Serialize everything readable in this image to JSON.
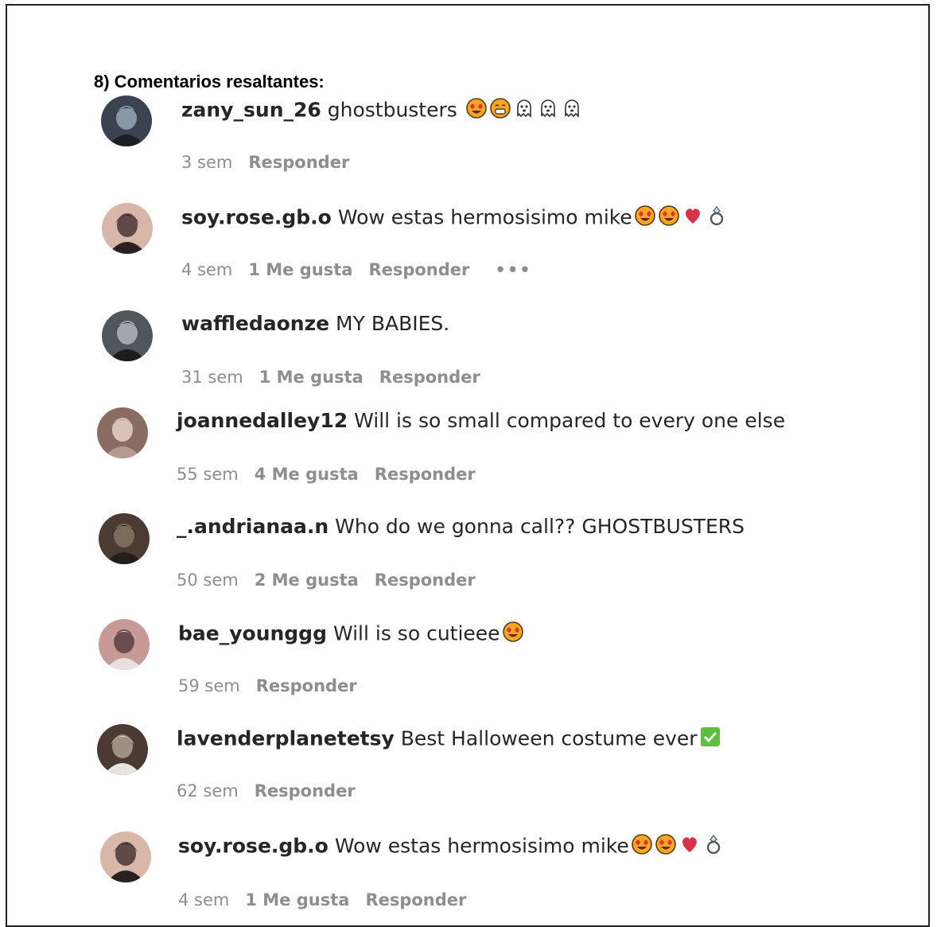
{
  "heading": "8) Comentarios resaltantes:",
  "comments": [
    {
      "username": "zany_sun_26",
      "text": "ghostbusters",
      "emojis": [
        "heart-eyes",
        "grin",
        "ghost",
        "ghost",
        "ghost"
      ],
      "time": "3 sem",
      "likes": "",
      "reply": "Responder",
      "more": ""
    },
    {
      "username": "soy.rose.gb.o",
      "text": "Wow estas hermosisimo mike",
      "emojis": [
        "heart-eyes",
        "heart-eyes",
        "heart",
        "ring"
      ],
      "time": "4 sem",
      "likes": "1 Me gusta",
      "reply": "Responder",
      "more": "•••"
    },
    {
      "username": "waffledaonze",
      "text": "MY BABIES.",
      "emojis": [],
      "time": "31 sem",
      "likes": "1 Me gusta",
      "reply": "Responder",
      "more": ""
    },
    {
      "username": "joannedalley12",
      "text": "Will is so small compared to every one else",
      "emojis": [],
      "time": "55 sem",
      "likes": "4 Me gusta",
      "reply": "Responder",
      "more": ""
    },
    {
      "username": "_.andrianaa.n",
      "text": "Who do we gonna call?? GHOSTBUSTERS",
      "emojis": [],
      "time": "50 sem",
      "likes": "2 Me gusta",
      "reply": "Responder",
      "more": ""
    },
    {
      "username": "bae_younggg",
      "text": "Will is so cutieee",
      "emojis": [
        "heart-eyes"
      ],
      "time": "59 sem",
      "likes": "",
      "reply": "Responder",
      "more": ""
    },
    {
      "username": "lavenderplanetetsy",
      "text": "Best Halloween costume ever",
      "emojis": [
        "check-box"
      ],
      "time": "62 sem",
      "likes": "",
      "reply": "Responder",
      "more": ""
    },
    {
      "username": "soy.rose.gb.o",
      "text": "Wow estas hermosisimo mike",
      "emojis": [
        "heart-eyes",
        "heart-eyes",
        "heart",
        "ring"
      ],
      "time": "4 sem",
      "likes": "1 Me gusta",
      "reply": "Responder",
      "more": ""
    }
  ],
  "colors": {
    "text": "#262626",
    "meta": "#8e8e8e",
    "emoji_face": "#f6a623",
    "emoji_heart_eyes": "#e0342f",
    "heart": "#d6334a",
    "check_box": "#5cbf3d"
  }
}
